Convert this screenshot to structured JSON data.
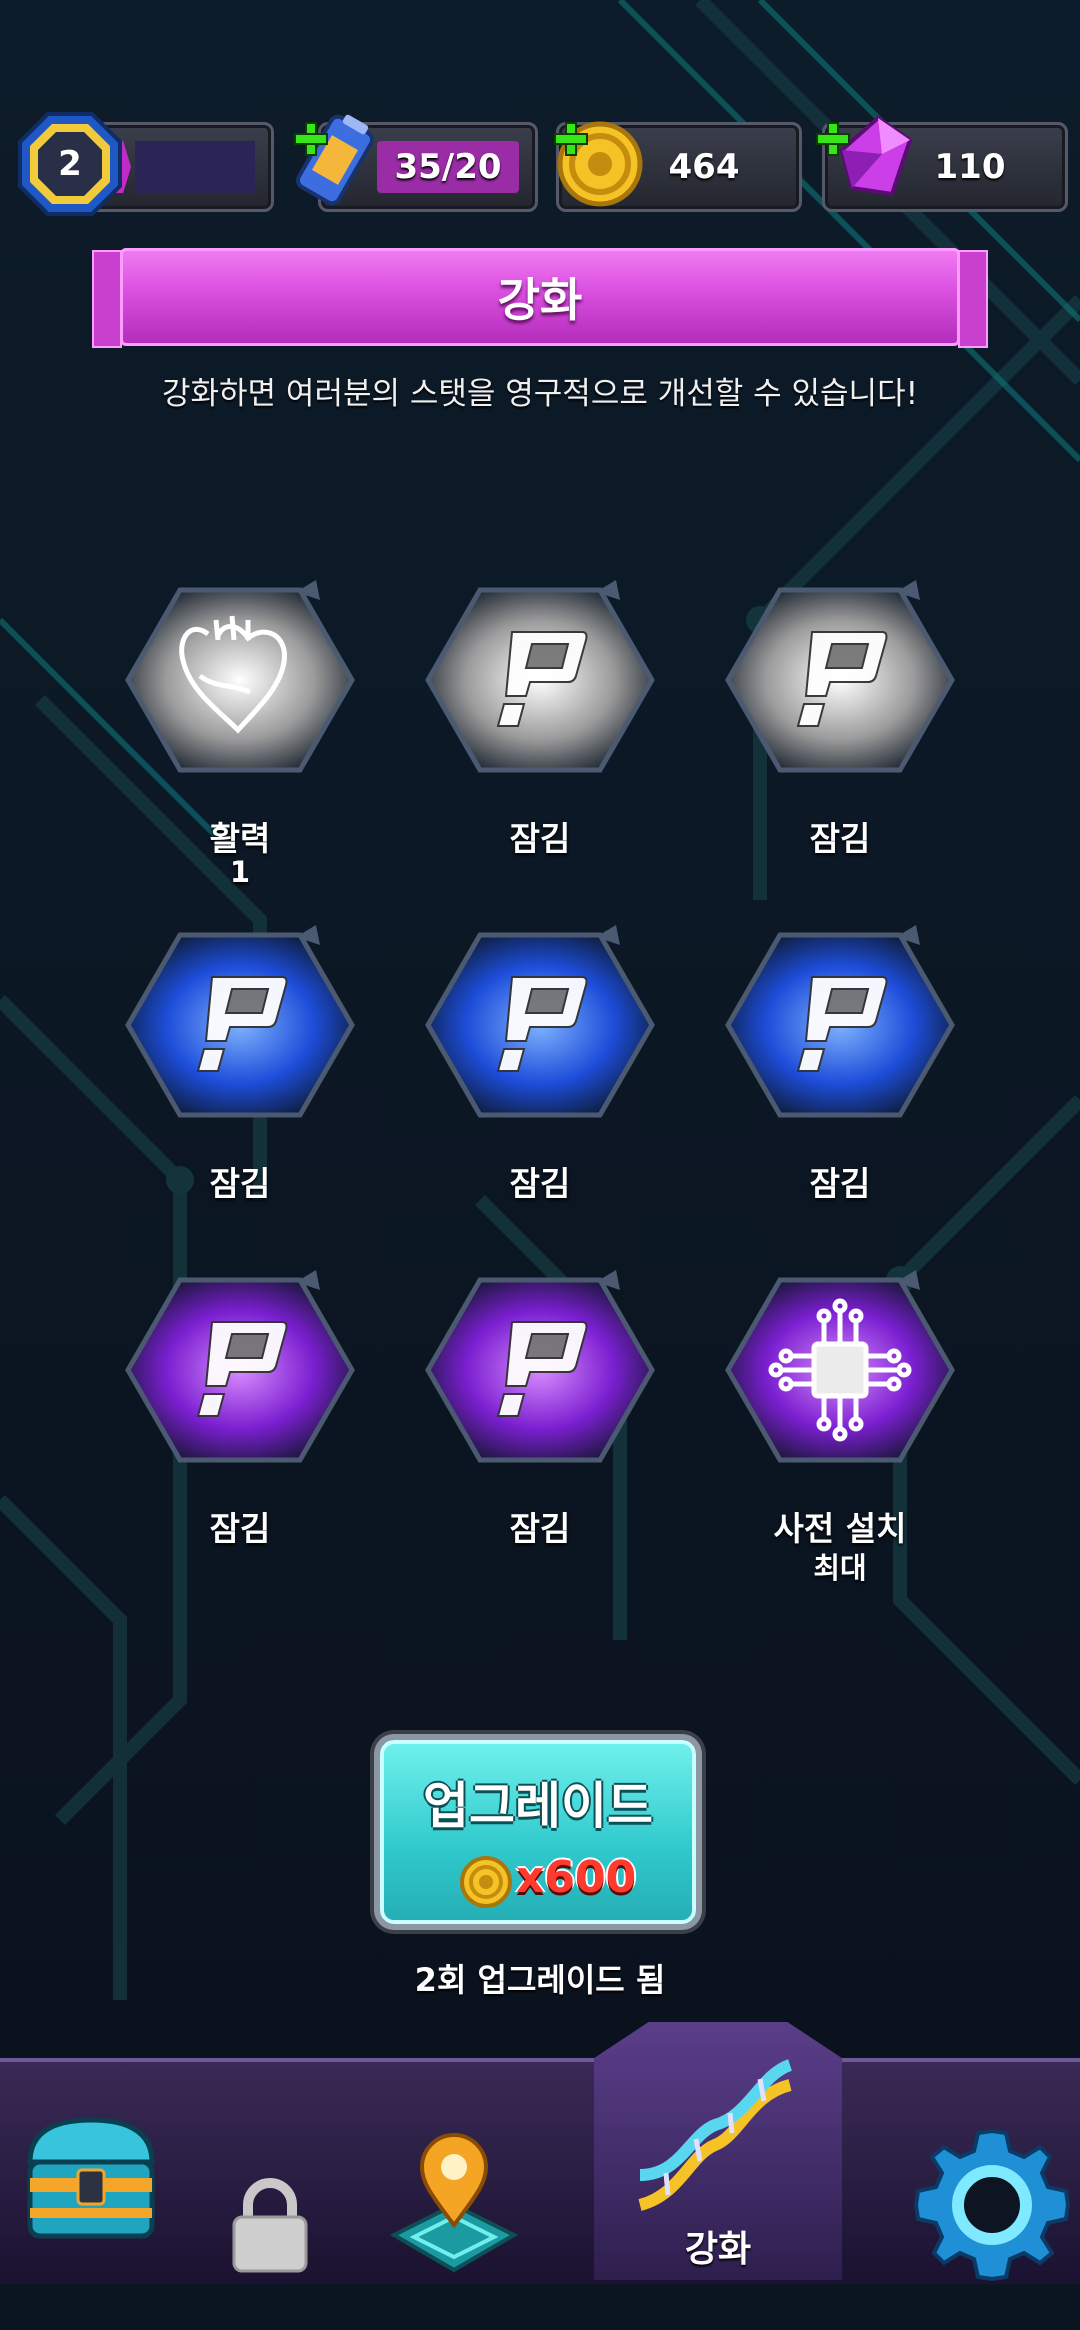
{
  "resources": {
    "level": "2",
    "energy": "35/20",
    "coins": "464",
    "gems": "110"
  },
  "banner": {
    "title": "강화",
    "subtitle": "강화하면 여러분의 스탯을 영구적으로 개선할 수 있습니다!"
  },
  "upgrades": [
    {
      "label": "활력",
      "sub": "1",
      "tier": "white",
      "icon": "heart-icon"
    },
    {
      "label": "잠김",
      "sub": "",
      "tier": "white",
      "icon": "lock-glyph-icon"
    },
    {
      "label": "잠김",
      "sub": "",
      "tier": "white",
      "icon": "lock-glyph-icon"
    },
    {
      "label": "잠김",
      "sub": "",
      "tier": "blue",
      "icon": "lock-glyph-icon"
    },
    {
      "label": "잠김",
      "sub": "",
      "tier": "blue",
      "icon": "lock-glyph-icon"
    },
    {
      "label": "잠김",
      "sub": "",
      "tier": "blue",
      "icon": "lock-glyph-icon"
    },
    {
      "label": "잠김",
      "sub": "",
      "tier": "purple",
      "icon": "lock-glyph-icon"
    },
    {
      "label": "잠김",
      "sub": "",
      "tier": "purple",
      "icon": "lock-glyph-icon"
    },
    {
      "label": "사전 설치",
      "sub": "최대",
      "tier": "purple",
      "icon": "chip-icon"
    }
  ],
  "upgrade_button": {
    "title": "업그레이드",
    "cost": "x600",
    "count_text": "2회 업그레이드 됨"
  },
  "nav": {
    "items": [
      "chest-icon",
      "padlock-icon",
      "map-pin-icon",
      "dna-icon",
      "gear-icon"
    ],
    "active_label": "강화"
  },
  "colors": {
    "accent_magenta": "#d94fdf",
    "accent_teal": "#2fc9cc",
    "tier_white": "#e8e8e8",
    "tier_blue": "#3f7bff",
    "tier_purple": "#a43cf5"
  }
}
